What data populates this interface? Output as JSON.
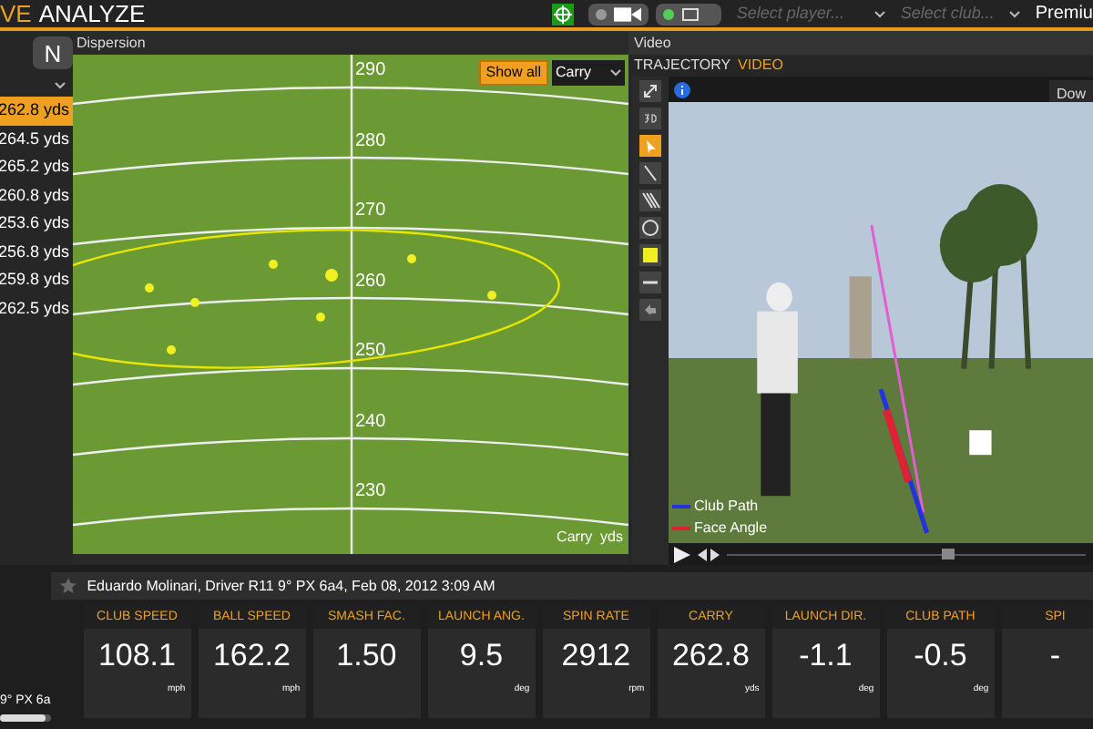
{
  "top_bar": {
    "tabs": [
      {
        "label": "VE",
        "selected": true
      },
      {
        "label": "ANALYZE",
        "selected": false
      }
    ],
    "camera_toggle": {
      "on": false
    },
    "monitor_toggle": {
      "on": true
    },
    "player_select": {
      "placeholder": "Select player..."
    },
    "club_select": {
      "placeholder": "Select club..."
    },
    "account": "Premiu"
  },
  "sidebar": {
    "buttons": [
      "N"
    ],
    "shots": [
      {
        "label": "262.8 yds",
        "selected": true
      },
      {
        "label": "264.5 yds",
        "selected": false
      },
      {
        "label": "265.2 yds",
        "selected": false
      },
      {
        "label": "260.8 yds",
        "selected": false
      },
      {
        "label": "253.6 yds",
        "selected": false
      },
      {
        "label": "256.8 yds",
        "selected": false
      },
      {
        "label": "259.8 yds",
        "selected": false
      },
      {
        "label": "262.5 yds",
        "selected": false
      }
    ],
    "footer": "9° PX 6a",
    "footer_slider": {
      "level": 0.9
    }
  },
  "dispersion": {
    "title": "Dispersion",
    "show_all": "Show all",
    "metric": "Carry",
    "distance_labels": [
      "290",
      "280",
      "270",
      "260",
      "250",
      "240",
      "230"
    ],
    "axis_label": "Carry  yds"
  },
  "video": {
    "title": "Video",
    "tabs": [
      {
        "label": "TRAJECTORY",
        "selected": false
      },
      {
        "label": "VIDEO",
        "selected": true
      }
    ],
    "tooltip": "Dow",
    "legend": [
      {
        "label": "Club Path",
        "color": "#2233dd"
      },
      {
        "label": "Face Angle",
        "color": "#dd2233"
      }
    ],
    "scrubber": {
      "level": 0.6
    }
  },
  "shot_info": "Eduardo Molinari, Driver R11 9° PX 6a4, Feb 08, 2012 3:09 AM",
  "metrics": [
    {
      "label": "CLUB SPEED",
      "value": "108.1",
      "unit": "mph"
    },
    {
      "label": "BALL SPEED",
      "value": "162.2",
      "unit": "mph"
    },
    {
      "label": "SMASH FAC.",
      "value": "1.50"
    },
    {
      "label": "LAUNCH ANG.",
      "value": "9.5",
      "unit": "deg"
    },
    {
      "label": "SPIN RATE",
      "value": "2912",
      "unit": "rpm"
    },
    {
      "label": "CARRY",
      "value": "262.8",
      "unit": "yds"
    },
    {
      "label": "LAUNCH DIR.",
      "value": "-1.1",
      "unit": "deg"
    },
    {
      "label": "CLUB PATH",
      "value": "-0.5",
      "unit": "deg"
    },
    {
      "label": "SPI",
      "value": "-"
    }
  ]
}
